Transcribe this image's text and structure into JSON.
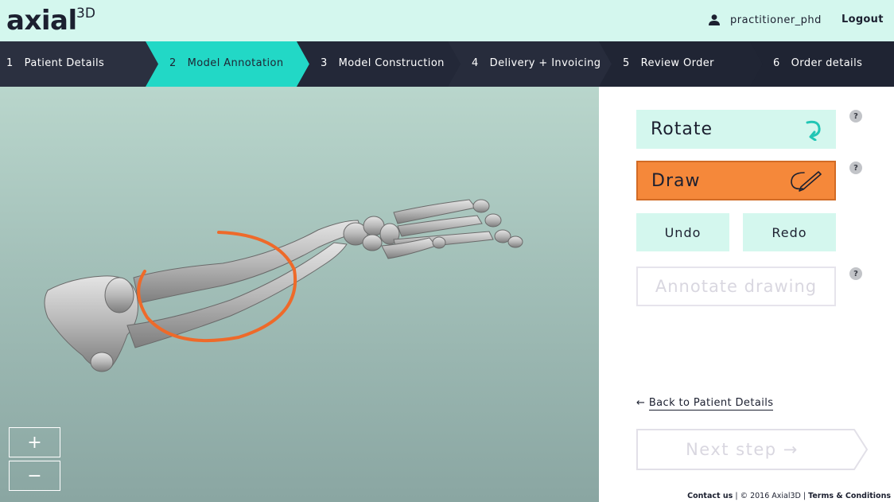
{
  "header": {
    "logo_text": "axial",
    "logo_sup": "3D",
    "username": "practitioner_phd",
    "logout_label": "Logout"
  },
  "steps": [
    {
      "num": "1",
      "label": "Patient Details",
      "active": false
    },
    {
      "num": "2",
      "label": "Model Annotation",
      "active": true
    },
    {
      "num": "3",
      "label": "Model Construction",
      "active": false
    },
    {
      "num": "4",
      "label": "Delivery + Invoicing",
      "active": false
    },
    {
      "num": "5",
      "label": "Review Order",
      "active": false
    },
    {
      "num": "6",
      "label": "Order details",
      "active": false
    }
  ],
  "viewer": {
    "zoom_in_label": "+",
    "zoom_out_label": "−"
  },
  "panel": {
    "rotate_label": "Rotate",
    "draw_label": "Draw",
    "undo_label": "Undo",
    "redo_label": "Redo",
    "annotate_label": "Annotate drawing",
    "help_symbol": "?",
    "back_arrow": "←",
    "back_label": "Back to Patient Details",
    "next_label": "Next step",
    "next_arrow": "→"
  },
  "footer": {
    "contact": "Contact us",
    "sep": "|",
    "copyright": "© 2016 Axial3D",
    "terms": "Terms & Conditions"
  },
  "colors": {
    "mint": "#d4f7ee",
    "navy": "#1f2433",
    "active_step": "#22d8c6",
    "draw_orange": "#f5883a",
    "annotation_stroke": "#ee6a2a",
    "disabled_text": "#d9d7e0"
  }
}
